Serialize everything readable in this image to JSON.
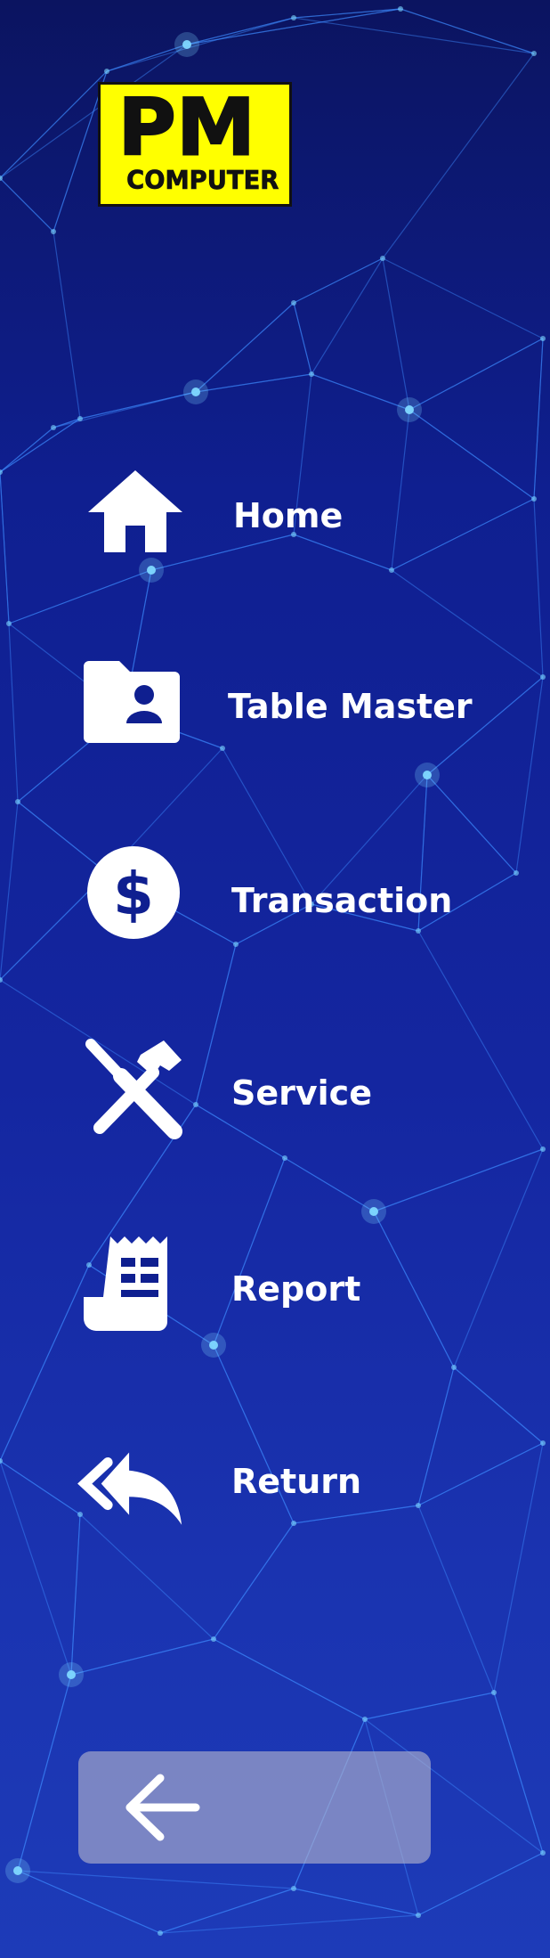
{
  "brand": {
    "logo_text_top": "PM",
    "logo_text_bottom": "COMPUTER"
  },
  "menu": {
    "items": [
      {
        "label": "Home",
        "icon": "home-icon"
      },
      {
        "label": "Table Master",
        "icon": "folder-user-icon"
      },
      {
        "label": "Transaction",
        "icon": "dollar-coin-icon"
      },
      {
        "label": "Service",
        "icon": "tools-icon"
      },
      {
        "label": "Report",
        "icon": "receipt-icon"
      },
      {
        "label": "Return",
        "icon": "reply-all-icon"
      }
    ]
  },
  "back_button": {
    "icon": "arrow-left-icon"
  },
  "colors": {
    "background_top": "#0b1460",
    "background_bottom": "#1d3bb8",
    "network_line": "#3f8cff",
    "node_glow": "#7fd8ff",
    "text": "#ffffff",
    "logo_yellow": "#ffff00",
    "back_button": "#b4b4cd"
  }
}
